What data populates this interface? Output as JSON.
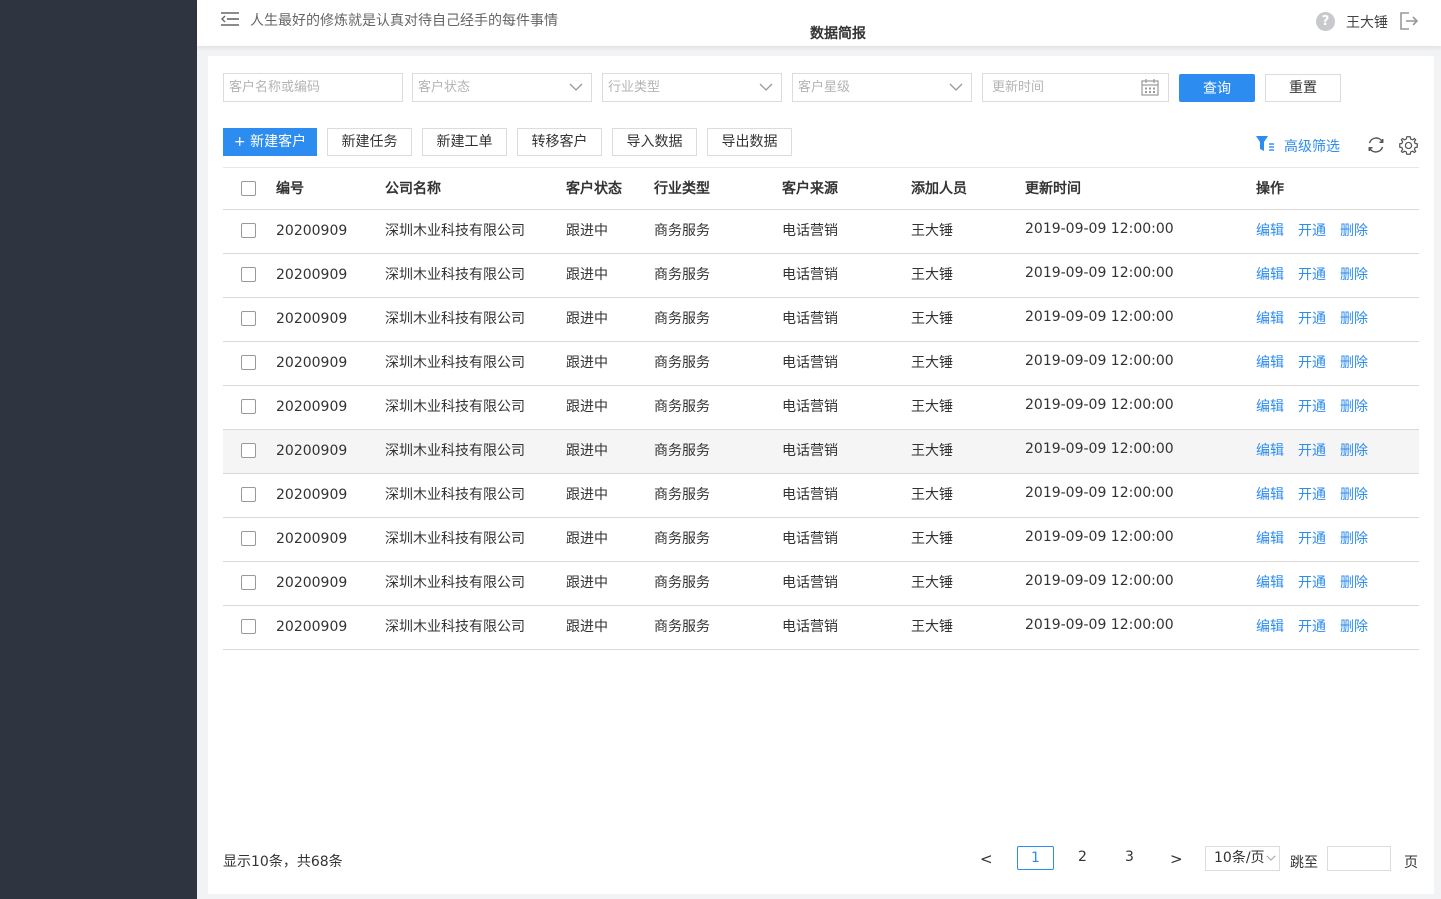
{
  "header": {
    "motto": "人生最好的修炼就是认真对待自己经手的每件事情",
    "page_title": "数据简报",
    "help_glyph": "?",
    "username": "王大锤"
  },
  "filters": {
    "search_placeholder": "客户名称或编码",
    "status_placeholder": "客户状态",
    "industry_placeholder": "行业类型",
    "level_placeholder": "客户星级",
    "time_placeholder": "更新时间",
    "query_label": "查询",
    "reset_label": "重置"
  },
  "toolbar": {
    "new_customer": "+ 新建客户",
    "new_task": "新建任务",
    "new_order": "新建工单",
    "transfer": "转移客户",
    "import": "导入数据",
    "export": "导出数据",
    "advanced_filter": "高级筛选"
  },
  "table": {
    "headers": [
      "编号",
      "公司名称",
      "客户状态",
      "行业类型",
      "客户来源",
      "添加人员",
      "更新时间",
      "操作"
    ],
    "ops": [
      "编辑",
      "开通",
      "删除"
    ],
    "rows": [
      {
        "id": "20200909",
        "name": "深圳木业科技有限公司",
        "status": "跟进中",
        "industry": "商务服务",
        "source": "电话营销",
        "adder": "王大锤",
        "time": "2019-09-09 12:00:00"
      },
      {
        "id": "20200909",
        "name": "深圳木业科技有限公司",
        "status": "跟进中",
        "industry": "商务服务",
        "source": "电话营销",
        "adder": "王大锤",
        "time": "2019-09-09 12:00:00"
      },
      {
        "id": "20200909",
        "name": "深圳木业科技有限公司",
        "status": "跟进中",
        "industry": "商务服务",
        "source": "电话营销",
        "adder": "王大锤",
        "time": "2019-09-09 12:00:00"
      },
      {
        "id": "20200909",
        "name": "深圳木业科技有限公司",
        "status": "跟进中",
        "industry": "商务服务",
        "source": "电话营销",
        "adder": "王大锤",
        "time": "2019-09-09 12:00:00"
      },
      {
        "id": "20200909",
        "name": "深圳木业科技有限公司",
        "status": "跟进中",
        "industry": "商务服务",
        "source": "电话营销",
        "adder": "王大锤",
        "time": "2019-09-09 12:00:00"
      },
      {
        "id": "20200909",
        "name": "深圳木业科技有限公司",
        "status": "跟进中",
        "industry": "商务服务",
        "source": "电话营销",
        "adder": "王大锤",
        "time": "2019-09-09 12:00:00"
      },
      {
        "id": "20200909",
        "name": "深圳木业科技有限公司",
        "status": "跟进中",
        "industry": "商务服务",
        "source": "电话营销",
        "adder": "王大锤",
        "time": "2019-09-09 12:00:00"
      },
      {
        "id": "20200909",
        "name": "深圳木业科技有限公司",
        "status": "跟进中",
        "industry": "商务服务",
        "source": "电话营销",
        "adder": "王大锤",
        "time": "2019-09-09 12:00:00"
      },
      {
        "id": "20200909",
        "name": "深圳木业科技有限公司",
        "status": "跟进中",
        "industry": "商务服务",
        "source": "电话营销",
        "adder": "王大锤",
        "time": "2019-09-09 12:00:00"
      },
      {
        "id": "20200909",
        "name": "深圳木业科技有限公司",
        "status": "跟进中",
        "industry": "商务服务",
        "source": "电话营销",
        "adder": "王大锤",
        "time": "2019-09-09 12:00:00"
      }
    ]
  },
  "pagination": {
    "summary": "显示10条，共68条",
    "prev": "<",
    "next": ">",
    "pages": [
      "1",
      "2",
      "3"
    ],
    "current": "1",
    "page_size": "10条/页",
    "jump_label": "跳至",
    "page_unit": "页"
  },
  "colors": {
    "accent": "#2d8cf0",
    "sidebar": "#2f3441",
    "highlight_row": "#f5f5f5"
  }
}
